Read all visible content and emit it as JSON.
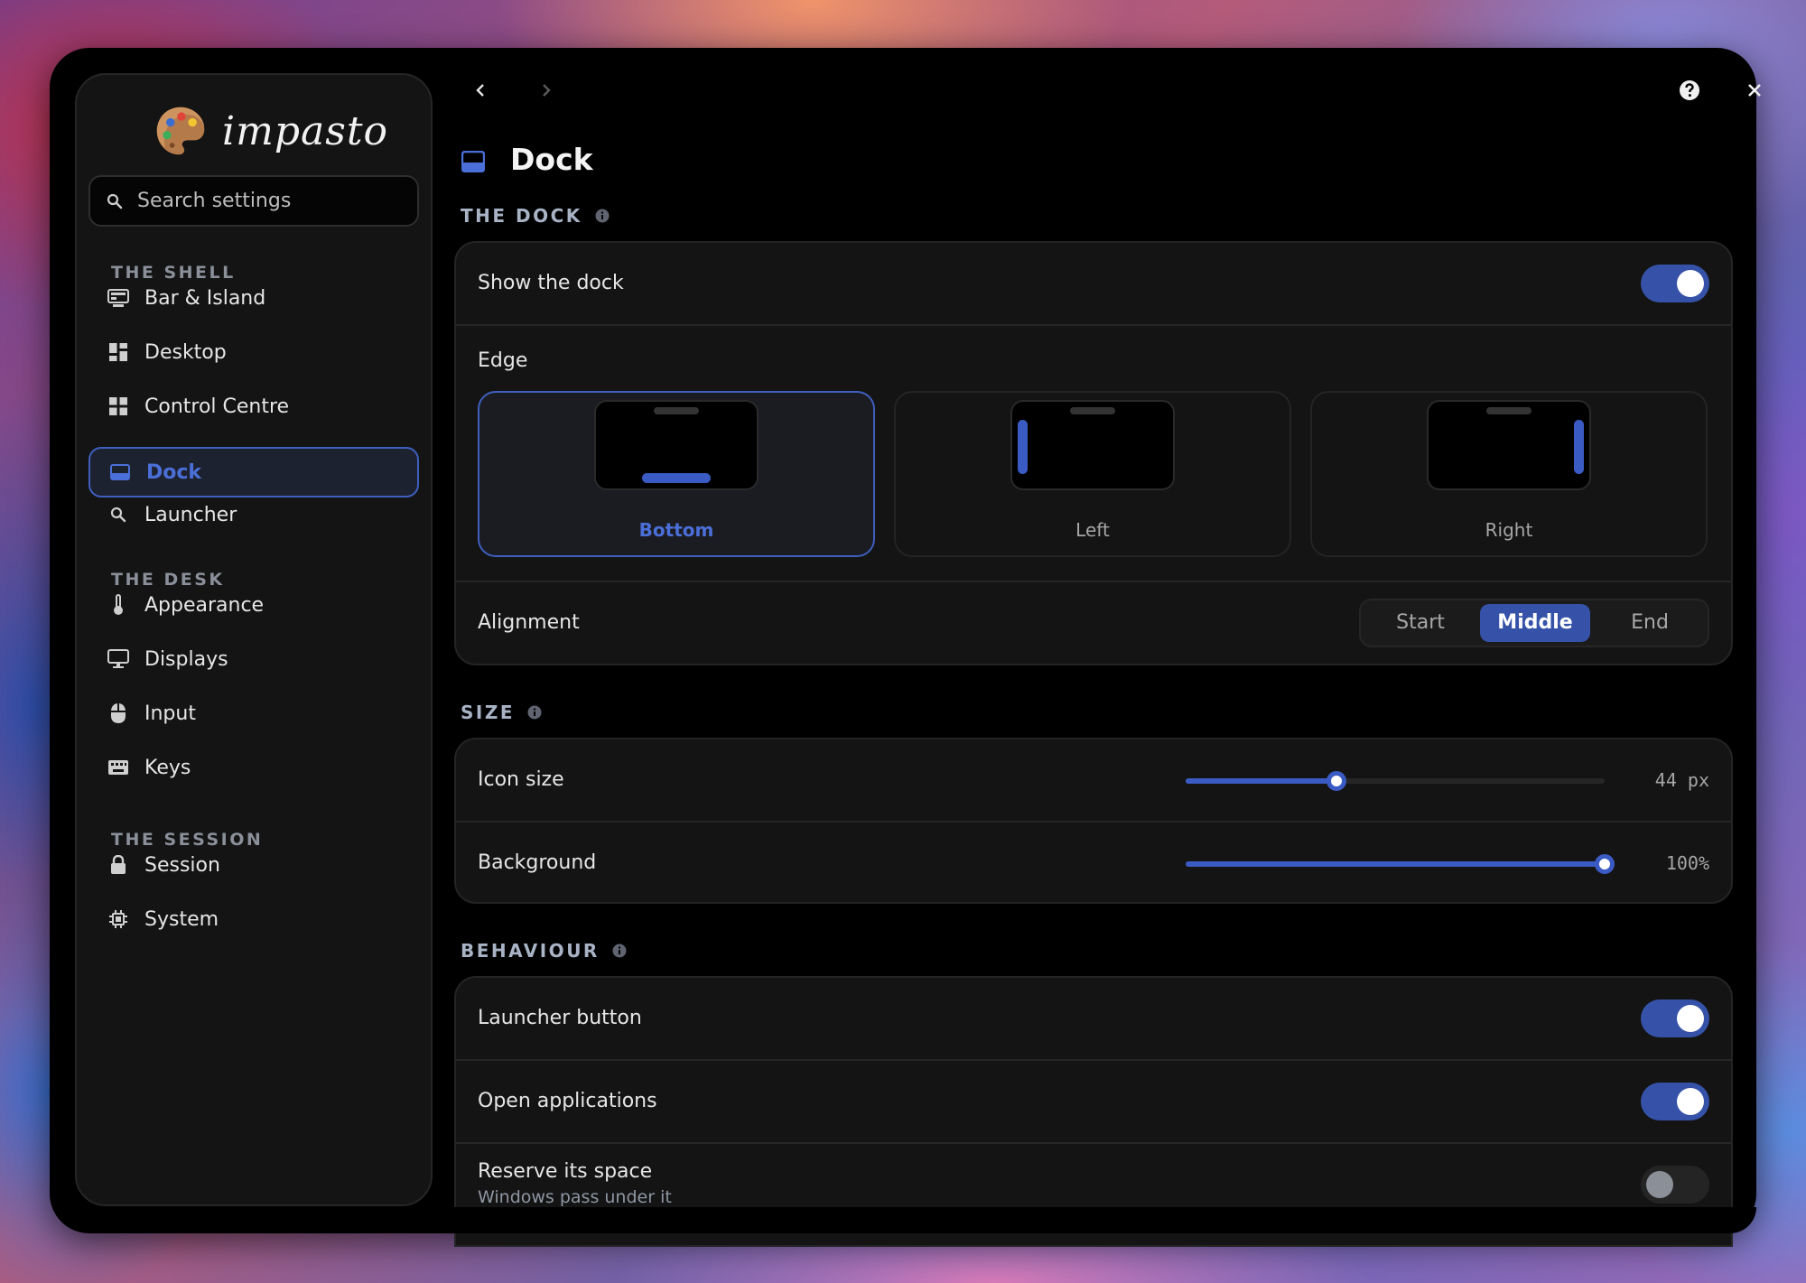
{
  "app": {
    "name": "impasto"
  },
  "search": {
    "placeholder": "Search settings"
  },
  "sidebar": {
    "sections": [
      {
        "label": "THE SHELL",
        "items": [
          {
            "label": "Bar & Island",
            "icon": "bar-icon"
          },
          {
            "label": "Desktop",
            "icon": "grid-icon"
          },
          {
            "label": "Control Centre",
            "icon": "grid-icon"
          },
          {
            "label": "Dock",
            "icon": "dock-icon",
            "active": true
          },
          {
            "label": "Launcher",
            "icon": "search-icon"
          }
        ]
      },
      {
        "label": "THE DESK",
        "items": [
          {
            "label": "Appearance",
            "icon": "thermometer-icon"
          },
          {
            "label": "Displays",
            "icon": "monitor-icon"
          },
          {
            "label": "Input",
            "icon": "mouse-icon"
          },
          {
            "label": "Keys",
            "icon": "keyboard-icon"
          }
        ]
      },
      {
        "label": "THE SESSION",
        "items": [
          {
            "label": "Session",
            "icon": "lock-icon"
          },
          {
            "label": "System",
            "icon": "chip-icon"
          }
        ]
      }
    ]
  },
  "page": {
    "title": "Dock"
  },
  "groups": {
    "dock": {
      "label": "THE DOCK",
      "show_dock": {
        "label": "Show the dock",
        "on": true
      },
      "edge": {
        "label": "Edge",
        "options": [
          {
            "label": "Bottom",
            "selected": true
          },
          {
            "label": "Left",
            "selected": false
          },
          {
            "label": "Right",
            "selected": false
          }
        ]
      },
      "alignment": {
        "label": "Alignment",
        "options": [
          "Start",
          "Middle",
          "End"
        ],
        "selected": "Middle"
      }
    },
    "size": {
      "label": "SIZE",
      "icon_size": {
        "label": "Icon size",
        "value_text": "44 px",
        "fraction": 0.36
      },
      "background": {
        "label": "Background",
        "value_text": "100%",
        "fraction": 1.0
      }
    },
    "behaviour": {
      "label": "BEHAVIOUR",
      "launcher_button": {
        "label": "Launcher button",
        "on": true
      },
      "open_applications": {
        "label": "Open applications",
        "on": true
      },
      "reserve_space": {
        "label": "Reserve its space",
        "sublabel": "Windows pass under it",
        "on": false
      }
    }
  },
  "colors": {
    "accent": "#3b5bc4",
    "accent_text": "#4b6fd8",
    "window_bg": "#000000",
    "card_bg": "#141414"
  }
}
